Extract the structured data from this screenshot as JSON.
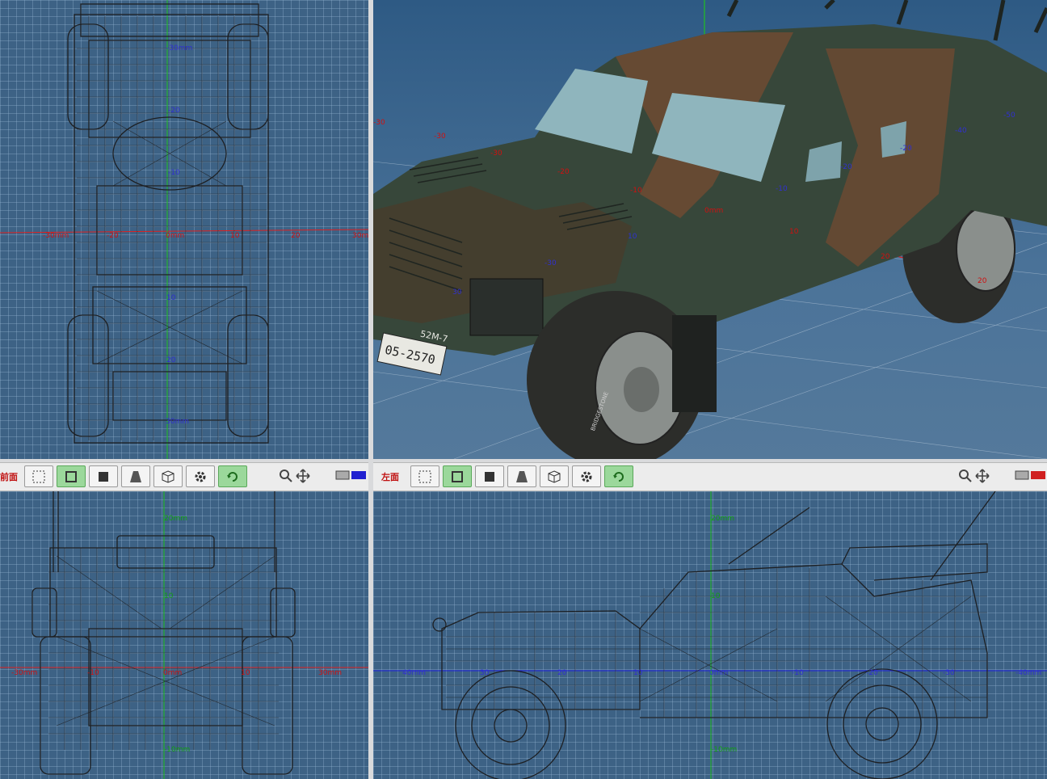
{
  "viewports": {
    "top": {
      "labels": {
        "y_neg30": "-30mm",
        "y_neg20": "-20",
        "y_neg10": "-10",
        "y_10": "10",
        "y_20": "20",
        "y_30": "30mm",
        "x_left": "-30mm",
        "x_neg20": "-20",
        "x_zero": "0mm",
        "x_10": "10",
        "x_20": "20",
        "x_right": "30m"
      }
    },
    "perspective": {
      "labels": {
        "a": "-30",
        "b": "-30",
        "c": "-20",
        "d": "-10",
        "e": "0mm",
        "f": "10",
        "g": "20",
        "h": "20",
        "i": "-10",
        "j": "-20",
        "k": "-40",
        "l": "-50",
        "m": "30",
        "n": "10",
        "o": "-30",
        "p": "-20",
        "q": "-30"
      },
      "plate_text": "05-2570",
      "unit_text": "52M-7",
      "tire_text": "BRIDGESTONE"
    },
    "front": {
      "labels": {
        "y_top": "20mm",
        "y_10": "10",
        "y_neg10": "-10mm",
        "x_left": "-30mm",
        "x_neg10": "-10",
        "x_zero": "0mm",
        "x_10": "10",
        "x_right": "30mm"
      }
    },
    "left": {
      "labels": {
        "y_top": "20mm",
        "y_10": "10",
        "y_neg10": "-10mm",
        "x_40": "40mm",
        "x_30": "30",
        "x_20": "20",
        "x_10": "10",
        "x_zero": "0mm",
        "x_neg10": "-10",
        "x_neg20": "-20",
        "x_neg30": "-30",
        "x_neg40": "-40mm"
      }
    }
  },
  "toolbars": {
    "left": {
      "view_label": "前面",
      "buttons": [
        "select-rect",
        "wireframe-frame",
        "solid",
        "perspective",
        "texture-cube",
        "settings",
        "rotate"
      ],
      "icons": [
        "zoom-icon",
        "move-icon",
        "display-icon"
      ]
    },
    "right": {
      "view_label": "左面",
      "buttons": [
        "select-rect",
        "wireframe-frame",
        "solid",
        "perspective",
        "texture-cube",
        "settings",
        "rotate"
      ],
      "icons": [
        "zoom-icon",
        "move-icon",
        "display-icon"
      ]
    }
  },
  "colors": {
    "viewport_bg": "#3d6285",
    "grid": "#96b4d2",
    "wire": "#1d1f22",
    "axis_red": "#e02020",
    "axis_green": "#20c020",
    "axis_blue": "#2020e0",
    "camo_green": "#37473a",
    "camo_brown": "#6b4a33",
    "active_button": "#9bd89b"
  }
}
